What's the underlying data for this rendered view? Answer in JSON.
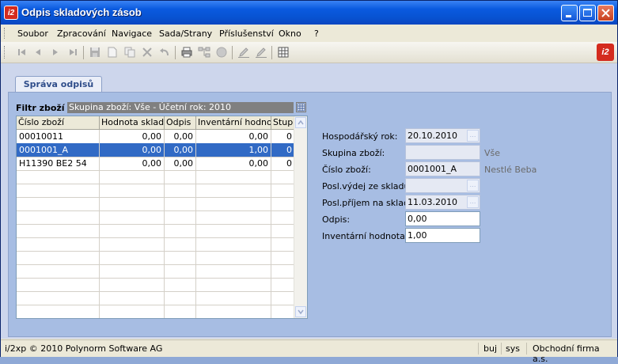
{
  "window": {
    "title": "Odpis skladových zásob",
    "app_icon_text": "i2",
    "buttons": [
      "minimize",
      "maximize",
      "close"
    ]
  },
  "menu": {
    "items": [
      "Soubor",
      "Zpracování",
      "Navigace",
      "Sada/Strany",
      "Příslušenství",
      "Okno",
      "?"
    ]
  },
  "toolbar": {
    "icons": [
      "first-record-icon",
      "previous-record-icon",
      "next-record-icon",
      "last-record-icon",
      "save-icon",
      "new-icon",
      "copy-icon",
      "delete-icon",
      "undo-icon",
      "print-icon",
      "tree-icon",
      "stop-icon",
      "edit-icon",
      "edit-field-icon",
      "table-icon"
    ],
    "logo_text": "i2"
  },
  "tab": {
    "label": "Správa odpisů"
  },
  "filter": {
    "label": "Filtr zboží",
    "value": "Skupina zboží: Vše - Účetní rok: 2010"
  },
  "grid": {
    "columns": [
      "Číslo zboží",
      "Hodnota skladu",
      "Odpis",
      "Inventární hodnota",
      "Stup."
    ],
    "rows": [
      {
        "cislo": "00010011",
        "hodnota": "0,00",
        "odpis": "0,00",
        "inventarni": "0,00",
        "stup": "0",
        "selected": false
      },
      {
        "cislo": "0001001_A",
        "hodnota": "0,00",
        "odpis": "0,00",
        "inventarni": "1,00",
        "stup": "0",
        "selected": true
      },
      {
        "cislo": "H11390 BE2 54",
        "hodnota": "0,00",
        "odpis": "0,00",
        "inventarni": "0,00",
        "stup": "0",
        "selected": false
      }
    ]
  },
  "form": {
    "hospodarsky_rok": {
      "label": "Hospodářský rok:",
      "value": "20.10.2010"
    },
    "skupina_zbozi": {
      "label": "Skupina zboží:",
      "value": "",
      "extra": "Vše"
    },
    "cislo_zbozi": {
      "label": "Číslo zboží:",
      "value": "0001001_A",
      "extra": "Nestlé Beba"
    },
    "posl_vydej": {
      "label": "Posl.výdej ze skladu:",
      "value": ""
    },
    "posl_prijem": {
      "label": "Posl.příjem na sklad:",
      "value": "11.03.2010"
    },
    "odpis": {
      "label": "Odpis:",
      "value": "0,00"
    },
    "inventarni_hodnota": {
      "label": "Inventární hodnota:",
      "value": "1,00"
    }
  },
  "status": {
    "copyright": "i/2xp © 2010 Polynorm Software AG",
    "user1": "buj",
    "user2": "sys",
    "company": "Obchodní firma a.s."
  }
}
